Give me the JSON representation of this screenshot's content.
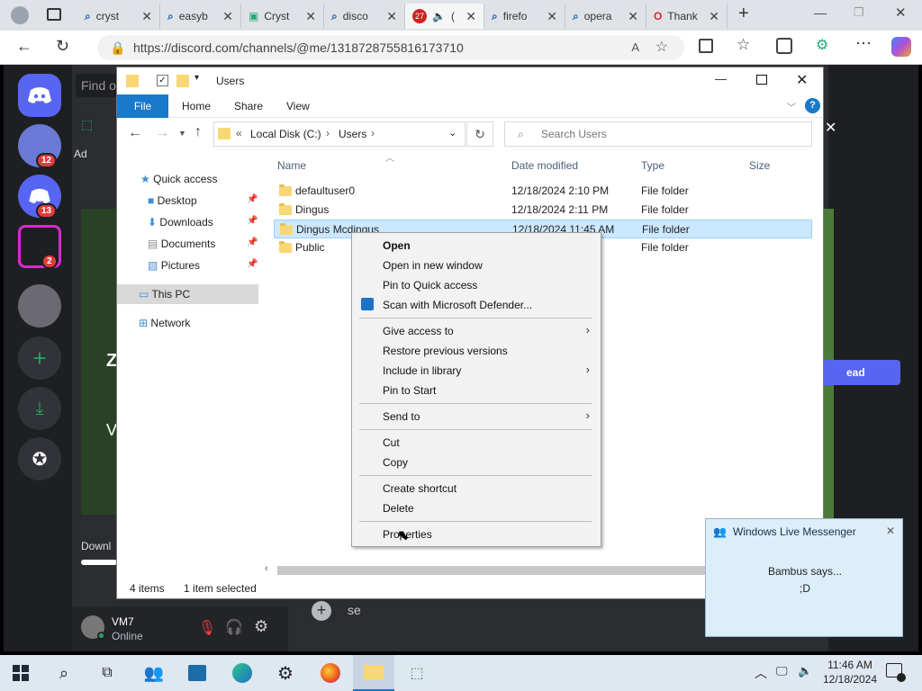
{
  "browser": {
    "tabs": [
      {
        "label": "cryst",
        "icon": "search-icon"
      },
      {
        "label": "easyb",
        "icon": "search-icon"
      },
      {
        "label": "Cryst",
        "icon": "page-icon"
      },
      {
        "label": "disco",
        "icon": "search-icon"
      },
      {
        "label": "(",
        "icon": "audio-icon",
        "badge": "27"
      },
      {
        "label": "firefo",
        "icon": "search-icon"
      },
      {
        "label": "opera",
        "icon": "search-icon"
      },
      {
        "label": "Thank",
        "icon": "opera-icon"
      }
    ],
    "url": "https://discord.com/channels/@me/1318728755816173710"
  },
  "discord": {
    "find_placeholder": "Find o",
    "badges": [
      "12",
      "13",
      "2"
    ],
    "side_text_ad": "Ad",
    "left_text_downl": "Downl",
    "message_input_placeholder": "se",
    "big_letter": "Z",
    "letter_v": "V",
    "right_button": "ead",
    "user": {
      "name": "VM7",
      "status": "Online"
    }
  },
  "explorer": {
    "title": "Users",
    "ribbon": {
      "file": "File",
      "home": "Home",
      "share": "Share",
      "view": "View"
    },
    "path": {
      "prefix": "«",
      "drive": "Local Disk (C:)",
      "sep": "›",
      "folder": "Users"
    },
    "search_placeholder": "Search Users",
    "nav": {
      "quick_access": "Quick access",
      "desktop": "Desktop",
      "downloads": "Downloads",
      "documents": "Documents",
      "pictures": "Pictures",
      "this_pc": "This PC",
      "network": "Network"
    },
    "columns": {
      "name": "Name",
      "date": "Date modified",
      "type": "Type",
      "size": "Size"
    },
    "rows": [
      {
        "name": "defaultuser0",
        "date": "12/18/2024 2:10 PM",
        "type": "File folder"
      },
      {
        "name": "Dingus",
        "date": "12/18/2024 2:11 PM",
        "type": "File folder"
      },
      {
        "name": "Dingus Mcdingus",
        "date": "12/18/2024 11:45 AM",
        "type": "File folder"
      },
      {
        "name": "Public",
        "date": "",
        "type": "File folder"
      }
    ],
    "status": {
      "count": "4 items",
      "selected": "1 item selected"
    }
  },
  "context_menu": {
    "open": "Open",
    "open_new_window": "Open in new window",
    "pin_quick_access": "Pin to Quick access",
    "scan_defender": "Scan with Microsoft Defender...",
    "give_access": "Give access to",
    "restore_versions": "Restore previous versions",
    "include_library": "Include in library",
    "pin_start": "Pin to Start",
    "send_to": "Send to",
    "cut": "Cut",
    "copy": "Copy",
    "create_shortcut": "Create shortcut",
    "delete": "Delete",
    "properties": "Properties"
  },
  "messenger": {
    "title": "Windows Live Messenger",
    "line1": "Bambus says...",
    "line2": ";D"
  },
  "taskbar": {
    "time": "11:46 AM",
    "date": "12/18/2024"
  }
}
